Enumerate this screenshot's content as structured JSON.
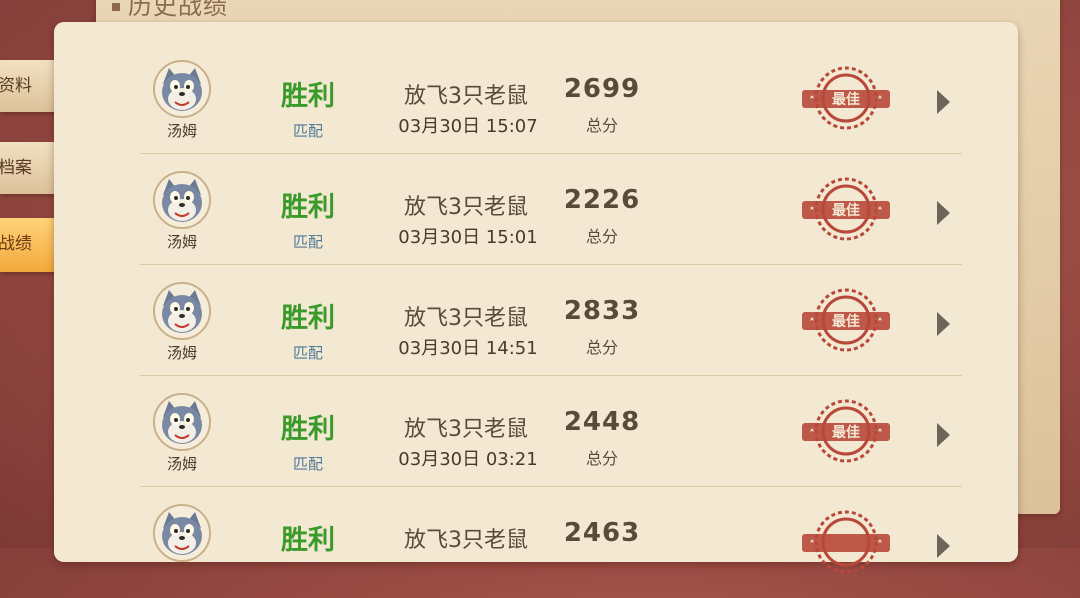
{
  "page_title": "历史战绩",
  "side_tabs": [
    {
      "label": "资料",
      "active": false
    },
    {
      "label": "档案",
      "active": false
    },
    {
      "label": "战绩",
      "active": true
    }
  ],
  "records": [
    {
      "player": "汤姆",
      "result": "胜利",
      "mode": "匹配",
      "objective": "放飞3只老鼠",
      "datetime": "03月30日 15:07",
      "score": "2699",
      "score_label": "总分",
      "badge": "最佳"
    },
    {
      "player": "汤姆",
      "result": "胜利",
      "mode": "匹配",
      "objective": "放飞3只老鼠",
      "datetime": "03月30日 15:01",
      "score": "2226",
      "score_label": "总分",
      "badge": "最佳"
    },
    {
      "player": "汤姆",
      "result": "胜利",
      "mode": "匹配",
      "objective": "放飞3只老鼠",
      "datetime": "03月30日 14:51",
      "score": "2833",
      "score_label": "总分",
      "badge": "最佳"
    },
    {
      "player": "汤姆",
      "result": "胜利",
      "mode": "匹配",
      "objective": "放飞3只老鼠",
      "datetime": "03月30日 03:21",
      "score": "2448",
      "score_label": "总分",
      "badge": "最佳"
    },
    {
      "player": "",
      "result": "胜利",
      "mode": "",
      "objective": "放飞3只老鼠",
      "datetime": "",
      "score": "2463",
      "score_label": "",
      "badge": ""
    }
  ],
  "colors": {
    "win": "#3a9a2a",
    "mode": "#4f7a9a",
    "stamp": "#b8483a",
    "tab_active": "#f3a93b"
  },
  "icons": {
    "avatar": "tom-cat-avatar-icon",
    "badge": "best-stamp-icon",
    "details": "chevron-right-icon"
  }
}
